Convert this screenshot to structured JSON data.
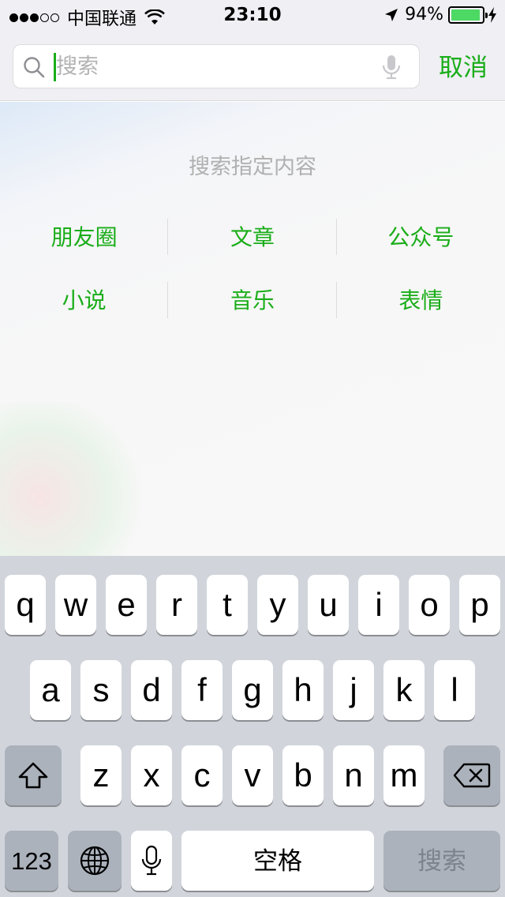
{
  "status_bar": {
    "carrier": "中国联通",
    "time": "23:10",
    "battery_percent": "94%",
    "battery_level": 0.94,
    "signal_bars_filled": 3,
    "signal_bars_total": 5,
    "icons": [
      "wifi-icon",
      "location-arrow-icon",
      "battery-icon",
      "charging-bolt-icon"
    ]
  },
  "search": {
    "placeholder": "搜索",
    "value": "",
    "cancel_label": "取消",
    "icons": [
      "search-icon",
      "microphone-icon"
    ]
  },
  "main": {
    "title": "搜索指定内容",
    "categories": [
      [
        "朋友圈",
        "文章",
        "公众号"
      ],
      [
        "小说",
        "音乐",
        "表情"
      ]
    ]
  },
  "keyboard": {
    "row1": [
      "q",
      "w",
      "e",
      "r",
      "t",
      "y",
      "u",
      "i",
      "o",
      "p"
    ],
    "row2": [
      "a",
      "s",
      "d",
      "f",
      "g",
      "h",
      "j",
      "k",
      "l"
    ],
    "row3": [
      "z",
      "x",
      "c",
      "v",
      "b",
      "n",
      "m"
    ],
    "numbers_label": "123",
    "space_label": "空格",
    "search_label": "搜索",
    "icons": [
      "shift-icon",
      "delete-icon",
      "globe-icon",
      "microphone-icon"
    ]
  },
  "colors": {
    "accent": "#1aad19",
    "battery": "#4cd964",
    "keyboard_bg": "#d1d5db",
    "dark_key": "#abb2bc"
  }
}
